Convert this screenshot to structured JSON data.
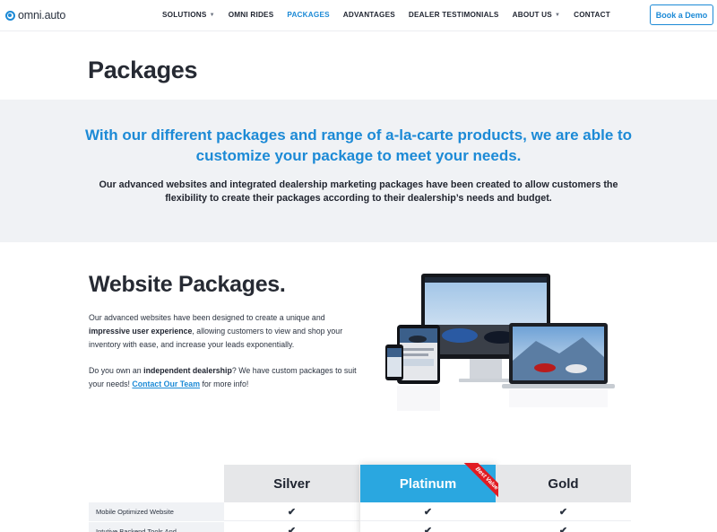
{
  "header": {
    "logo_text": "omni.auto",
    "nav": [
      {
        "label": "SOLUTIONS",
        "dropdown": true,
        "active": false
      },
      {
        "label": "OMNI RIDES",
        "dropdown": false,
        "active": false
      },
      {
        "label": "PACKAGES",
        "dropdown": false,
        "active": true
      },
      {
        "label": "ADVANTAGES",
        "dropdown": false,
        "active": false
      },
      {
        "label": "DEALER TESTIMONIALS",
        "dropdown": false,
        "active": false
      },
      {
        "label": "ABOUT US",
        "dropdown": true,
        "active": false
      },
      {
        "label": "CONTACT",
        "dropdown": false,
        "active": false
      }
    ],
    "cta_label": "Book a Demo"
  },
  "page_title": "Packages",
  "intro": {
    "lead": "With our different packages and range of a-la-carte products, we are able to customize your package to meet your needs.",
    "body": "Our advanced websites and integrated dealership marketing packages have been created to allow customers the flexibility to create their packages according to their dealership’s needs and budget."
  },
  "website_packages": {
    "title": "Website Packages.",
    "p1_a": "Our advanced websites have been designed to create a unique and ",
    "p1_bold": "impressive user experience",
    "p1_b": ", allowing customers to view and shop your inventory with ease, and increase your leads exponentially.",
    "p2_a": "Do you own an ",
    "p2_bold": "independent dealership",
    "p2_b": "? We have custom packages to suit your needs! ",
    "p2_link": "Contact Our Team",
    "p2_c": " for more info!"
  },
  "pricing": {
    "plans": [
      "Silver",
      "Platinum",
      "Gold"
    ],
    "badge": "Best Value",
    "features": [
      "Mobile Optimized Website",
      "Intutive Backend Tools And"
    ],
    "checks": [
      [
        true,
        true,
        true
      ],
      [
        true,
        true,
        true
      ]
    ]
  },
  "colors": {
    "accent": "#1c8ad6",
    "platinum_header": "#2aa7e0",
    "badge": "#e11b22",
    "band_bg": "#f0f2f5"
  }
}
